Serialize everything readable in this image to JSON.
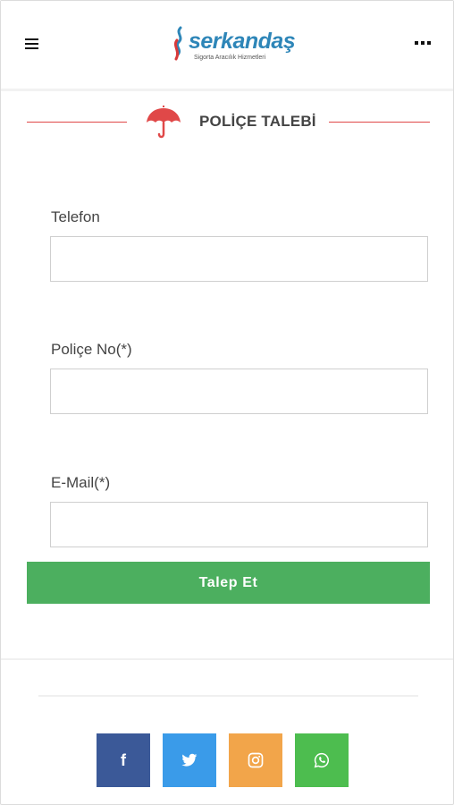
{
  "header": {
    "brand_name": "serkandaş",
    "brand_tagline": "Sigorta Aracılık Hizmetleri",
    "brand_color": "#2e86b8",
    "menu_icon": "hamburger-icon",
    "more_icon": "more-dots-icon"
  },
  "section": {
    "title": "POLİÇE TALEBİ",
    "icon": "umbrella-icon",
    "accent_color": "#e04848"
  },
  "form": {
    "phone_label": "Telefon",
    "phone_value": "",
    "policy_label": "Poliçe No(*)",
    "policy_value": "",
    "email_label": "E-Mail(*)",
    "email_value": "",
    "submit_label": "Talep Et",
    "submit_color": "#4caf5f"
  },
  "social": [
    {
      "name": "facebook",
      "glyph": "f",
      "color": "#3b5998"
    },
    {
      "name": "twitter",
      "glyph": "twitter-bird",
      "color": "#3a9be9"
    },
    {
      "name": "instagram",
      "glyph": "instagram-camera",
      "color": "#f2a54a"
    },
    {
      "name": "whatsapp",
      "glyph": "whatsapp-phone",
      "color": "#4dbd4f"
    }
  ]
}
